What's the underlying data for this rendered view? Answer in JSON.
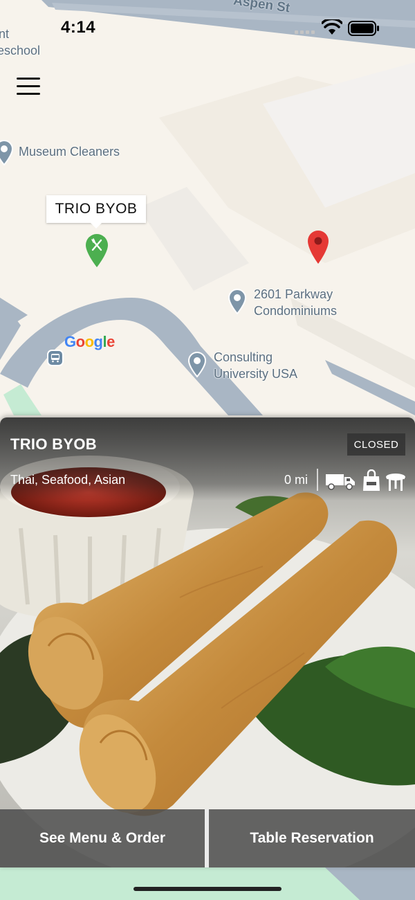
{
  "status_bar": {
    "time": "4:14"
  },
  "map": {
    "street_label": "Aspen St",
    "edge_label_line1": "nt",
    "edge_label_line2": "eschool",
    "pois": [
      {
        "name": "Museum Cleaners"
      },
      {
        "name_line1": "2601 Parkway",
        "name_line2": "Condominiums"
      },
      {
        "name_line1": "Consulting",
        "name_line2": "University USA"
      }
    ],
    "selected_callout": "TRIO BYOB",
    "google_letters": [
      "G",
      "o",
      "o",
      "g",
      "l",
      "e"
    ],
    "colors": {
      "land": "#f7f3ec",
      "road": "#a9b6c4",
      "restaurant_pin": "#4caf50",
      "location_pin": "#e53935"
    }
  },
  "restaurant": {
    "name": "TRIO BYOB",
    "status": "CLOSED",
    "cuisine": "Thai, Seafood, Asian",
    "distance": "0 mi",
    "services": [
      "delivery-truck-icon",
      "takeout-bag-icon",
      "dine-in-table-icon"
    ]
  },
  "actions": {
    "menu_label": "See Menu & Order",
    "reserve_label": "Table Reservation"
  }
}
